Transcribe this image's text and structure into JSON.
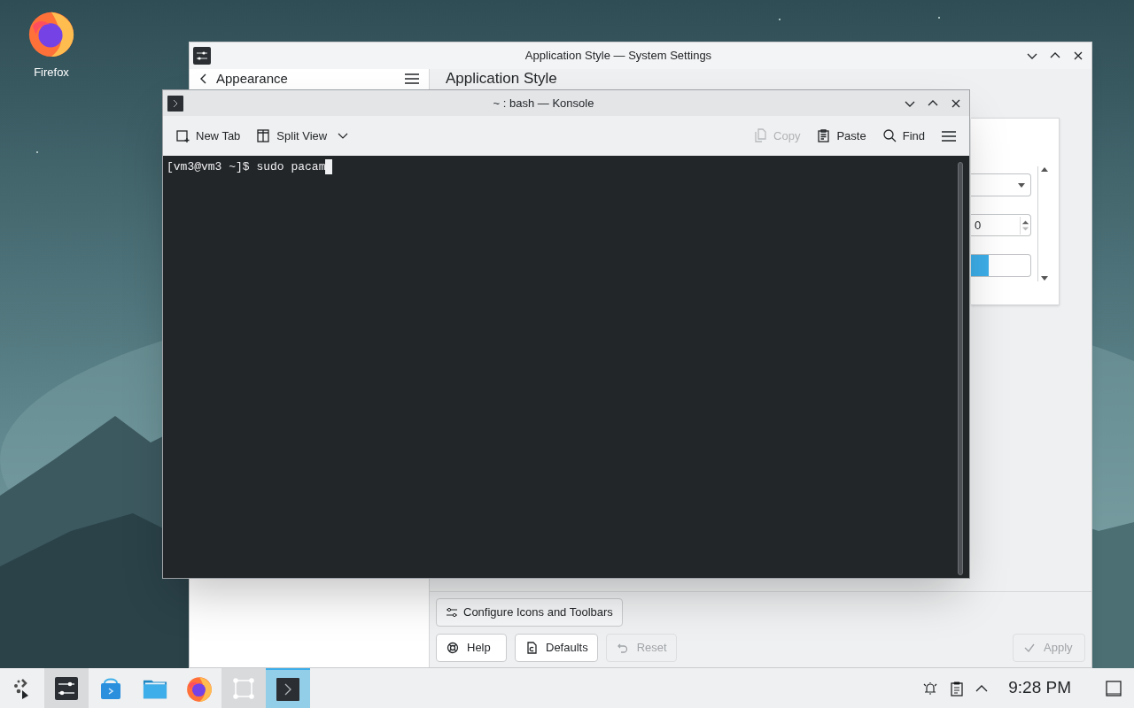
{
  "desktop_icons": [
    {
      "label": "Firefox"
    }
  ],
  "settings_window": {
    "title": "Application Style — System Settings",
    "back_label": "Appearance",
    "page_title": "Application Style",
    "spin_value": "0",
    "configure_button": "Configure Icons and Toolbars",
    "buttons": [
      {
        "kind": "help",
        "label": "Help",
        "disabled": false
      },
      {
        "kind": "defaults",
        "label": "Defaults",
        "disabled": false
      },
      {
        "kind": "reset",
        "label": "Reset",
        "disabled": true
      },
      {
        "kind": "apply",
        "label": "Apply",
        "disabled": true
      }
    ]
  },
  "terminal_window": {
    "title": "~ : bash — Konsole",
    "toolbar_left": [
      {
        "kind": "new-tab",
        "label": "New Tab"
      },
      {
        "kind": "split-view",
        "label": "Split View"
      }
    ],
    "toolbar_right": [
      {
        "kind": "copy",
        "label": "Copy",
        "disabled": true
      },
      {
        "kind": "paste",
        "label": "Paste",
        "disabled": false
      },
      {
        "kind": "find",
        "label": "Find",
        "disabled": false
      }
    ],
    "line": "[vm3@vm3 ~]$ sudo pacam"
  },
  "taskbar": {
    "apps": [
      {
        "kind": "launcher",
        "selected": false,
        "open": false
      },
      {
        "kind": "settings",
        "selected": false,
        "open": true
      },
      {
        "kind": "discover",
        "selected": false,
        "open": false
      },
      {
        "kind": "files",
        "selected": false,
        "open": false
      },
      {
        "kind": "firefox",
        "selected": false,
        "open": false
      },
      {
        "kind": "overview",
        "selected": false,
        "open": true
      },
      {
        "kind": "konsole",
        "selected": true,
        "open": true
      }
    ],
    "clock": "9:28 PM"
  }
}
